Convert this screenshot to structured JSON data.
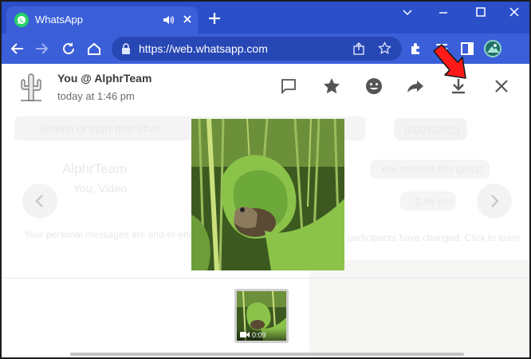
{
  "browser": {
    "tab_title": "WhatsApp",
    "url": "https://web.whatsapp.com",
    "accent_color": "#2a4fc9"
  },
  "viewer": {
    "sender": "You @ AlphrTeam",
    "time": "today at 1:46 pm",
    "actions": [
      "message-icon",
      "star-icon",
      "emoji-icon",
      "forward-icon",
      "download-icon",
      "close-icon"
    ]
  },
  "background": {
    "search_text": "Search or start new chat",
    "date_label": "03/07/2023",
    "chat_name": "AlphrTeam",
    "chat_preview": "You, Video",
    "system_message": "You created this group",
    "time_pill": "1:46 pm",
    "encryption_notice": "Your personal messages are end-to-end",
    "participant_notice": "participants have changed. Click to learn"
  },
  "thumbnails": [
    {
      "duration": "0:09",
      "type": "video"
    }
  ],
  "annotation": {
    "color": "#ff1a1a"
  }
}
